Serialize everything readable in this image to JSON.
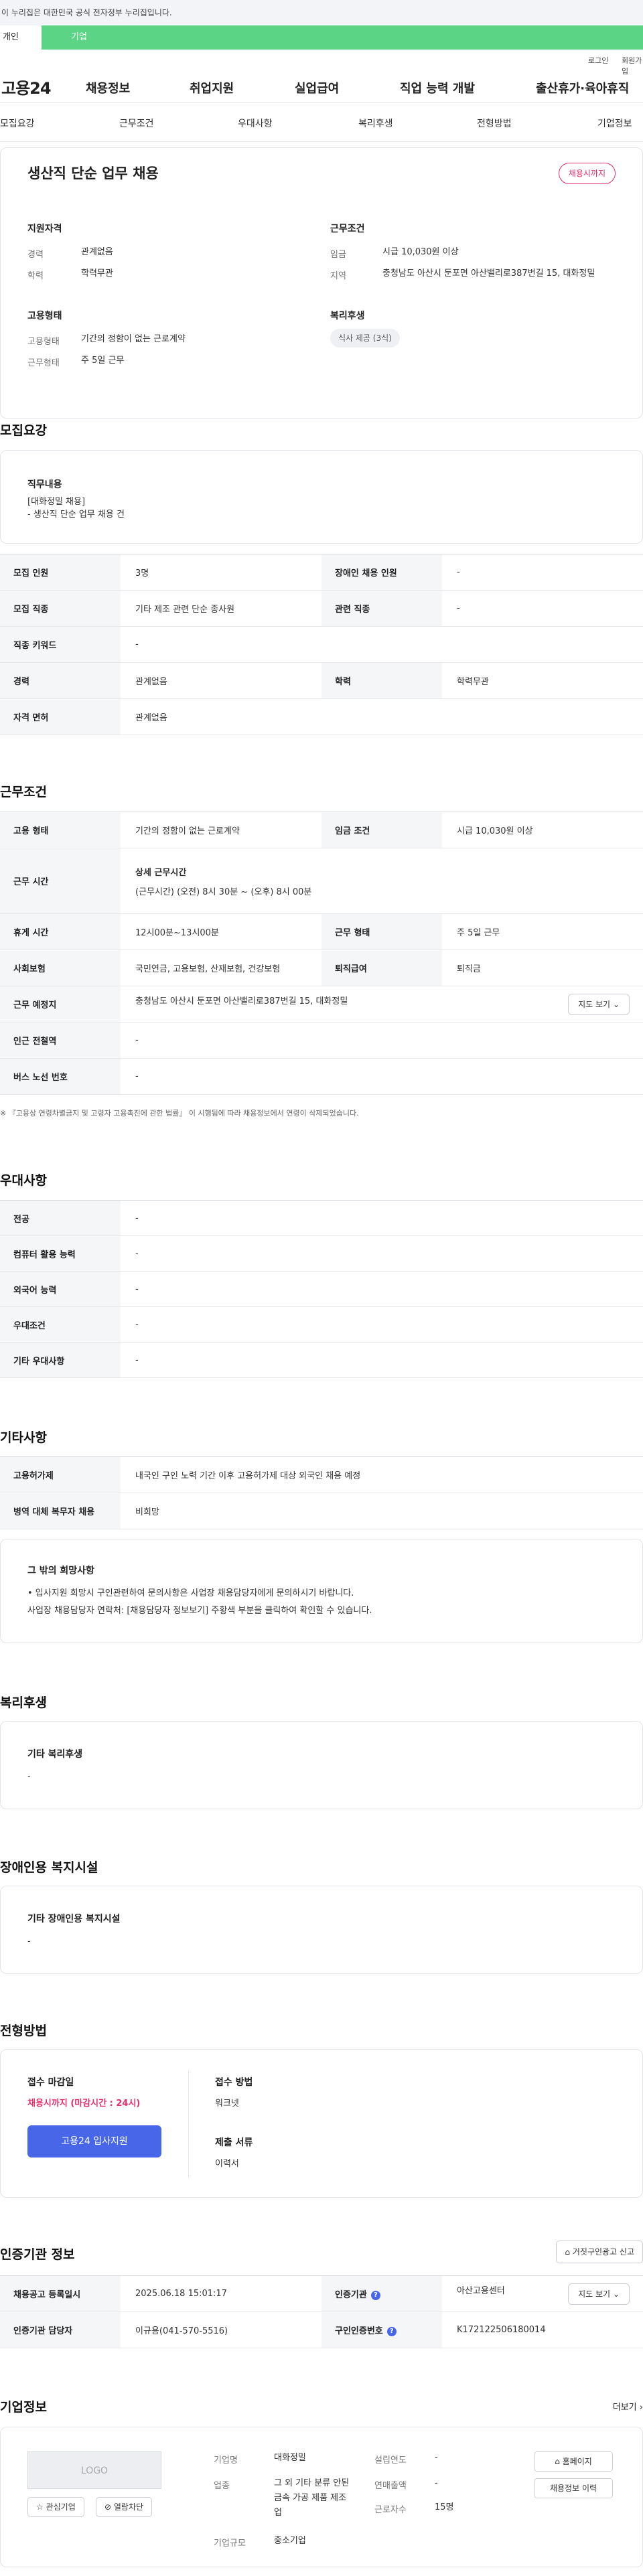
{
  "gov_banner": "이 누리집은 대한민국 공식 전자정부 누리집입니다.",
  "tabs": {
    "personal": "개인",
    "company": "기업"
  },
  "util": {
    "login": "로그인",
    "join": "회원가입"
  },
  "gnb": {
    "logo": "고용24",
    "menu": [
      "채용정보",
      "취업지원",
      "실업급여",
      "직업 능력 개발",
      "출산휴가·육아휴직"
    ]
  },
  "anchor": [
    "모집요강",
    "근무조건",
    "우대사항",
    "복리후생",
    "전형방법",
    "기업정보"
  ],
  "summary": {
    "title": "생산직 단순 업무 채용",
    "badge": "채용시까지",
    "qual_title": "지원자격",
    "career_k": "경력",
    "career_v": "관계없음",
    "edu_k": "학력",
    "edu_v": "학력무관",
    "emp_title": "고용형태",
    "emptype_k": "고용형태",
    "emptype_v": "기간의 정함이 없는 근로계약",
    "workform_k": "근무형태",
    "workform_v": "주 5일 근무",
    "cond_title": "근무조건",
    "wage_k": "임금",
    "wage_v": "시급 10,030원 이상",
    "area_k": "지역",
    "area_v": "충청남도 아산시 둔포면 아산밸리로387번길 15, 대화정밀",
    "welfare_title": "복리후생",
    "welfare_chip": "식사 제공 (3식)"
  },
  "recruit": {
    "heading": "모집요강",
    "duty_title": "직무내용",
    "duty_body_1": "[대화정밀 채용]",
    "duty_body_2": "- 생산직 단순 업무 채용 건",
    "rows": {
      "count_k": "모집 인원",
      "count_v": "3명",
      "disabled_k": "장애인 채용 인원",
      "disabled_v": "-",
      "job_k": "모집 직종",
      "job_v": "기타 제조 관련 단순 종사원",
      "related_k": "관련 직종",
      "related_v": "-",
      "keyword_k": "직종 키워드",
      "keyword_v": "-",
      "career_k": "경력",
      "career_v": "관계없음",
      "edu_k": "학력",
      "edu_v": "학력무관",
      "license_k": "자격 면허",
      "license_v": "관계없음"
    }
  },
  "work": {
    "heading": "근무조건",
    "emp_k": "고용 형태",
    "emp_v": "기간의 정함이 없는 근로계약",
    "wage_k": "임금 조건",
    "wage_v": "시급 10,030원 이상",
    "time_k": "근무 시간",
    "time_title": "상세 근무시간",
    "time_v": "(근무시간) (오전) 8시 30분 ~ (오후) 8시 00분",
    "rest_k": "휴게 시간",
    "rest_v": "12시00분~13시00분",
    "form_k": "근무 형태",
    "form_v": "주 5일 근무",
    "ins_k": "사회보험",
    "ins_v": "국민연금, 고용보험, 산재보험, 건강보험",
    "retire_k": "퇴직급여",
    "retire_v": "퇴직금",
    "place_k": "근무 예정지",
    "place_v": "충청남도 아산시 둔포면 아산밸리로387번길 15, 대화정밀",
    "map_btn": "지도 보기",
    "subway_k": "인근 전철역",
    "subway_v": "-",
    "bus_k": "버스 노선 번호",
    "bus_v": "-",
    "note": "※ 『고용상 연령차별금지 및 고령자 고용촉진에 관한 법률』 이 시행됨에 따라 채용정보에서 연령이 삭제되었습니다."
  },
  "pref": {
    "heading": "우대사항",
    "rows": [
      {
        "k": "전공",
        "v": "-"
      },
      {
        "k": "컴퓨터 활용 능력",
        "v": "-"
      },
      {
        "k": "외국어 능력",
        "v": "-"
      },
      {
        "k": "우대조건",
        "v": "-"
      },
      {
        "k": "기타 우대사항",
        "v": "-"
      }
    ]
  },
  "etc": {
    "heading": "기타사항",
    "foreign_k": "고용허가제",
    "foreign_v": "내국인 구인 노력 기간 이후 고용허가제 대상 외국인 채용 예정",
    "military_k": "병역 대체 복무자 채용",
    "military_v": "비희망",
    "hope_title": "그 밖의 희망사항",
    "hope_1": "• 입사지원 희망시 구인관련하여 문의사항은 사업장 채용담당자에게 문의하시기 바랍니다.",
    "hope_2": "사업장 채용담당자 연락처: [채용담당자 정보보기] 주황색 부분을 클릭하여 확인할 수 있습니다."
  },
  "welfare": {
    "heading": "복리후생",
    "title": "기타 복리후생",
    "value": "-"
  },
  "disabled": {
    "heading": "장애인용 복지시설",
    "title": "기타 장애인용 복지시설",
    "value": "-"
  },
  "selection": {
    "heading": "전형방법",
    "deadline_title": "접수 마감일",
    "deadline_value": "채용시까지 (마감시간 : 24시)",
    "apply_btn": "고용24 입사지원",
    "method_title": "접수 방법",
    "method_value": "워크넷",
    "docs_title": "제출 서류",
    "docs_value": "이력서"
  },
  "cert": {
    "heading": "인증기관 정보",
    "report_btn": "거짓구인광고 신고",
    "reg_k": "채용공고 등록일시",
    "reg_v": "2025.06.18 15:01:17",
    "org_k": "인증기관",
    "org_v": "아산고용센터",
    "map_btn": "지도 보기",
    "manager_k": "인증기관 담당자",
    "manager_v": "이규용(041-570-5516)",
    "num_k": "구인인증번호",
    "num_v": "K172122506180014"
  },
  "company": {
    "heading": "기업정보",
    "more": "더보기",
    "logo": "LOGO",
    "interest_btn": "관심기업",
    "block_btn": "열람차단",
    "name_k": "기업명",
    "name_v": "대화정밀",
    "founded_k": "설립연도",
    "founded_v": "-",
    "industry_k": "업종",
    "industry_v": "그 외 기타 분류 안된 금속 가공 제품 제조업",
    "sales_k": "연매출액",
    "sales_v": "-",
    "staff_k": "근로자수",
    "staff_v": "15명",
    "size_k": "기업규모",
    "size_v": "중소기업",
    "homepage_btn": "홈페이지",
    "jobs_btn": "채용정보 이력"
  }
}
